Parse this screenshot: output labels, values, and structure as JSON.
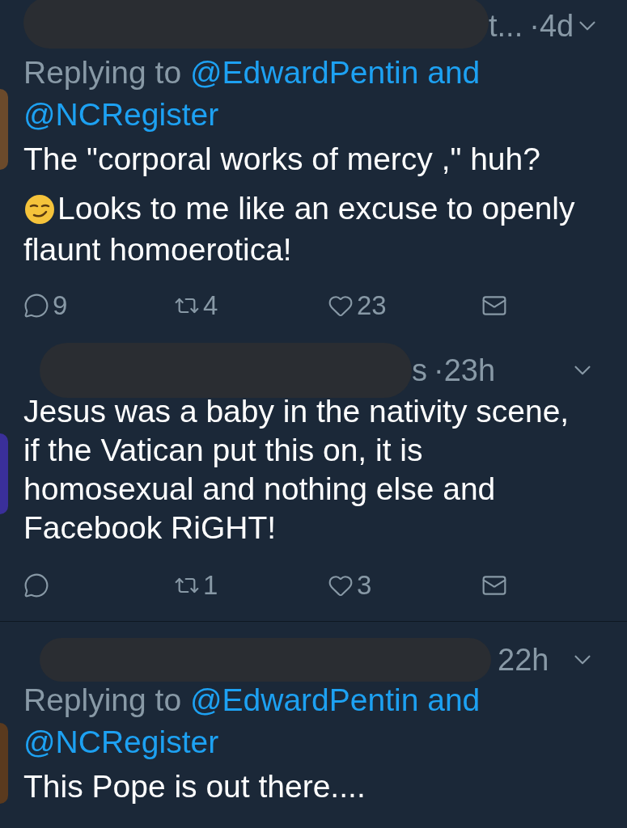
{
  "tweets": [
    {
      "header": {
        "redacted": true,
        "name_fragment": "t...",
        "time": "·4d"
      },
      "replying": {
        "prefix": "Replying to",
        "mention": "@EdwardPentin and",
        "mention_2": "@NCRegister"
      },
      "body": [
        {
          "kind": "text",
          "text": "The \"corporal works of mercy ,\" huh?"
        },
        {
          "kind": "emoji",
          "text": "Looks to me like an excuse to openly flaunt homoerotica!"
        }
      ],
      "actions": {
        "reply": "9",
        "retweet": "4",
        "like": "23"
      }
    },
    {
      "header": {
        "redacted": true,
        "name_fragment": "s",
        "time": "·23h"
      },
      "body": [
        {
          "kind": "text",
          "text": "Jesus was a baby in the nativity scene, if the Vatican put this on, it is homosexual and nothing else and Facebook RiGHT!"
        }
      ],
      "actions": {
        "retweet": "1",
        "like": "3"
      }
    },
    {
      "header": {
        "redacted": true,
        "time": "22h"
      },
      "replying": {
        "prefix": "Replying to",
        "mention": "@EdwardPentin and",
        "mention_2": "@NCRegister"
      },
      "body": [
        {
          "kind": "text",
          "text": "This Pope is out there...."
        }
      ]
    }
  ]
}
